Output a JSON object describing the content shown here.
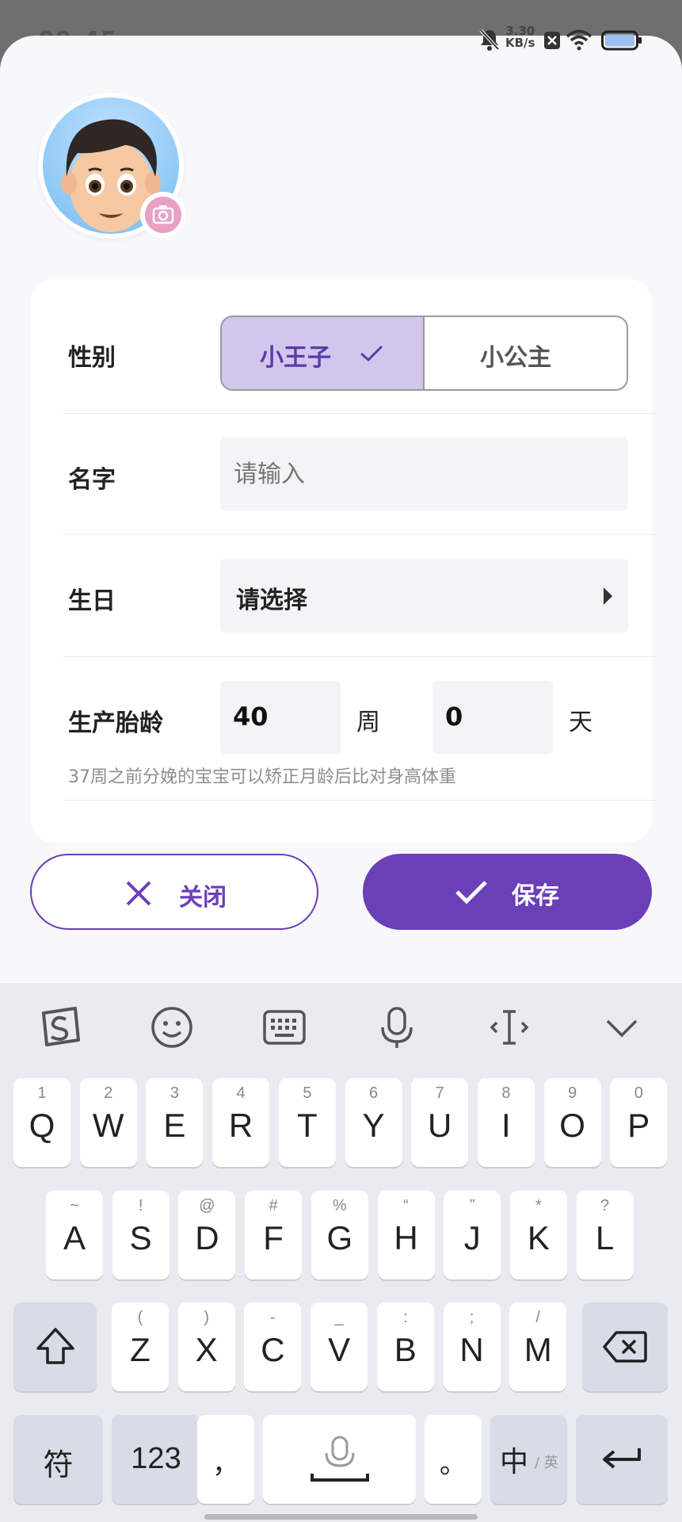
{
  "status_bar": {
    "time": "09:45",
    "speed_value": "3.30",
    "speed_unit": "KB/s",
    "icons": [
      "bell-muted-icon",
      "close-box-icon",
      "wifi-icon",
      "battery-icon"
    ]
  },
  "avatar": {
    "icon": "boy-emoji-avatar",
    "camera_icon": "camera-icon"
  },
  "form": {
    "gender": {
      "label": "性别",
      "options": [
        "小王子",
        "小公主"
      ],
      "selected": "小王子"
    },
    "name": {
      "label": "名字",
      "placeholder": "请输入"
    },
    "birthday": {
      "label": "生日",
      "value": "请选择"
    },
    "gestation": {
      "label": "生产胎龄",
      "weeks": "40",
      "weeks_unit": "周",
      "days": "0",
      "days_unit": "天",
      "hint": "37周之前分娩的宝宝可以矫正月龄后比对身高体重"
    }
  },
  "buttons": {
    "close": "关闭",
    "save": "保存"
  },
  "colors": {
    "accent": "#6a3fb8",
    "selected_bg": "#d3c6ec"
  },
  "keyboard": {
    "toolbar": [
      "sogou-logo-icon",
      "emoji-icon",
      "keyboard-icon",
      "microphone-icon",
      "cursor-icon",
      "chevron-down-icon"
    ],
    "row1": [
      {
        "main": "Q",
        "sub": "1"
      },
      {
        "main": "W",
        "sub": "2"
      },
      {
        "main": "E",
        "sub": "3"
      },
      {
        "main": "R",
        "sub": "4"
      },
      {
        "main": "T",
        "sub": "5"
      },
      {
        "main": "Y",
        "sub": "6"
      },
      {
        "main": "U",
        "sub": "7"
      },
      {
        "main": "I",
        "sub": "8"
      },
      {
        "main": "O",
        "sub": "9"
      },
      {
        "main": "P",
        "sub": "0"
      }
    ],
    "row2": [
      {
        "main": "A",
        "sub": "~"
      },
      {
        "main": "S",
        "sub": "!"
      },
      {
        "main": "D",
        "sub": "@"
      },
      {
        "main": "F",
        "sub": "#"
      },
      {
        "main": "G",
        "sub": "%"
      },
      {
        "main": "H",
        "sub": "“"
      },
      {
        "main": "J",
        "sub": "”"
      },
      {
        "main": "K",
        "sub": "*"
      },
      {
        "main": "L",
        "sub": "?"
      }
    ],
    "row3": [
      {
        "main": "Z",
        "sub": "("
      },
      {
        "main": "X",
        "sub": ")"
      },
      {
        "main": "C",
        "sub": "-"
      },
      {
        "main": "V",
        "sub": "_"
      },
      {
        "main": "B",
        "sub": ":"
      },
      {
        "main": "N",
        "sub": ";"
      },
      {
        "main": "M",
        "sub": "/"
      }
    ],
    "bottom": {
      "symbols": "符",
      "numbers": "123",
      "comma": "，",
      "period": "。",
      "lang_main": "中",
      "lang_sub": "/ 英"
    }
  }
}
